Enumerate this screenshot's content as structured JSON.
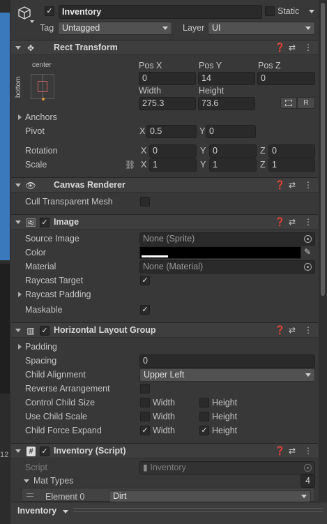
{
  "header": {
    "object_name": "Inventory",
    "static_label": "Static",
    "tag_label": "Tag",
    "tag_value": "Untagged",
    "layer_label": "Layer",
    "layer_value": "UI"
  },
  "rect_transform": {
    "title": "Rect Transform",
    "anchor_h": "center",
    "anchor_v": "bottom",
    "pos_x_label": "Pos X",
    "pos_x": "0",
    "pos_y_label": "Pos Y",
    "pos_y": "14",
    "pos_z_label": "Pos Z",
    "pos_z": "0",
    "width_label": "Width",
    "width": "275.3",
    "height_label": "Height",
    "height": "73.6",
    "r_button": "R",
    "anchors_label": "Anchors",
    "pivot_label": "Pivot",
    "pivot_x_label": "X",
    "pivot_x": "0.5",
    "pivot_y_label": "Y",
    "pivot_y": "0",
    "rotation_label": "Rotation",
    "rot_x_label": "X",
    "rot_x": "0",
    "rot_y_label": "Y",
    "rot_y": "0",
    "rot_z_label": "Z",
    "rot_z": "0",
    "scale_label": "Scale",
    "scale_x_label": "X",
    "scale_x": "1",
    "scale_y_label": "Y",
    "scale_y": "1",
    "scale_z_label": "Z",
    "scale_z": "1"
  },
  "canvas_renderer": {
    "title": "Canvas Renderer",
    "cull_label": "Cull Transparent Mesh"
  },
  "image": {
    "title": "Image",
    "source_label": "Source Image",
    "source_value": "None (Sprite)",
    "color_label": "Color",
    "color_value": "#000000",
    "material_label": "Material",
    "material_value": "None (Material)",
    "raycast_target_label": "Raycast Target",
    "raycast_padding_label": "Raycast Padding",
    "maskable_label": "Maskable"
  },
  "layout_group": {
    "title": "Horizontal Layout Group",
    "padding_label": "Padding",
    "spacing_label": "Spacing",
    "spacing_value": "0",
    "alignment_label": "Child Alignment",
    "alignment_value": "Upper Left",
    "reverse_label": "Reverse Arrangement",
    "control_size_label": "Control Child Size",
    "use_scale_label": "Use Child Scale",
    "force_expand_label": "Child Force Expand",
    "width_label": "Width",
    "height_label": "Height"
  },
  "script": {
    "title": "Inventory (Script)",
    "script_label": "Script",
    "script_value": "Inventory",
    "mat_types_label": "Mat Types",
    "mat_types_count": "4",
    "element0_label": "Element 0",
    "element0_value": "Dirt"
  },
  "bottom": {
    "breadcrumb": "Inventory"
  },
  "left": {
    "number": "12"
  },
  "colors": {
    "accent_blue": "#3a79bb",
    "panel_bg": "#383838"
  }
}
